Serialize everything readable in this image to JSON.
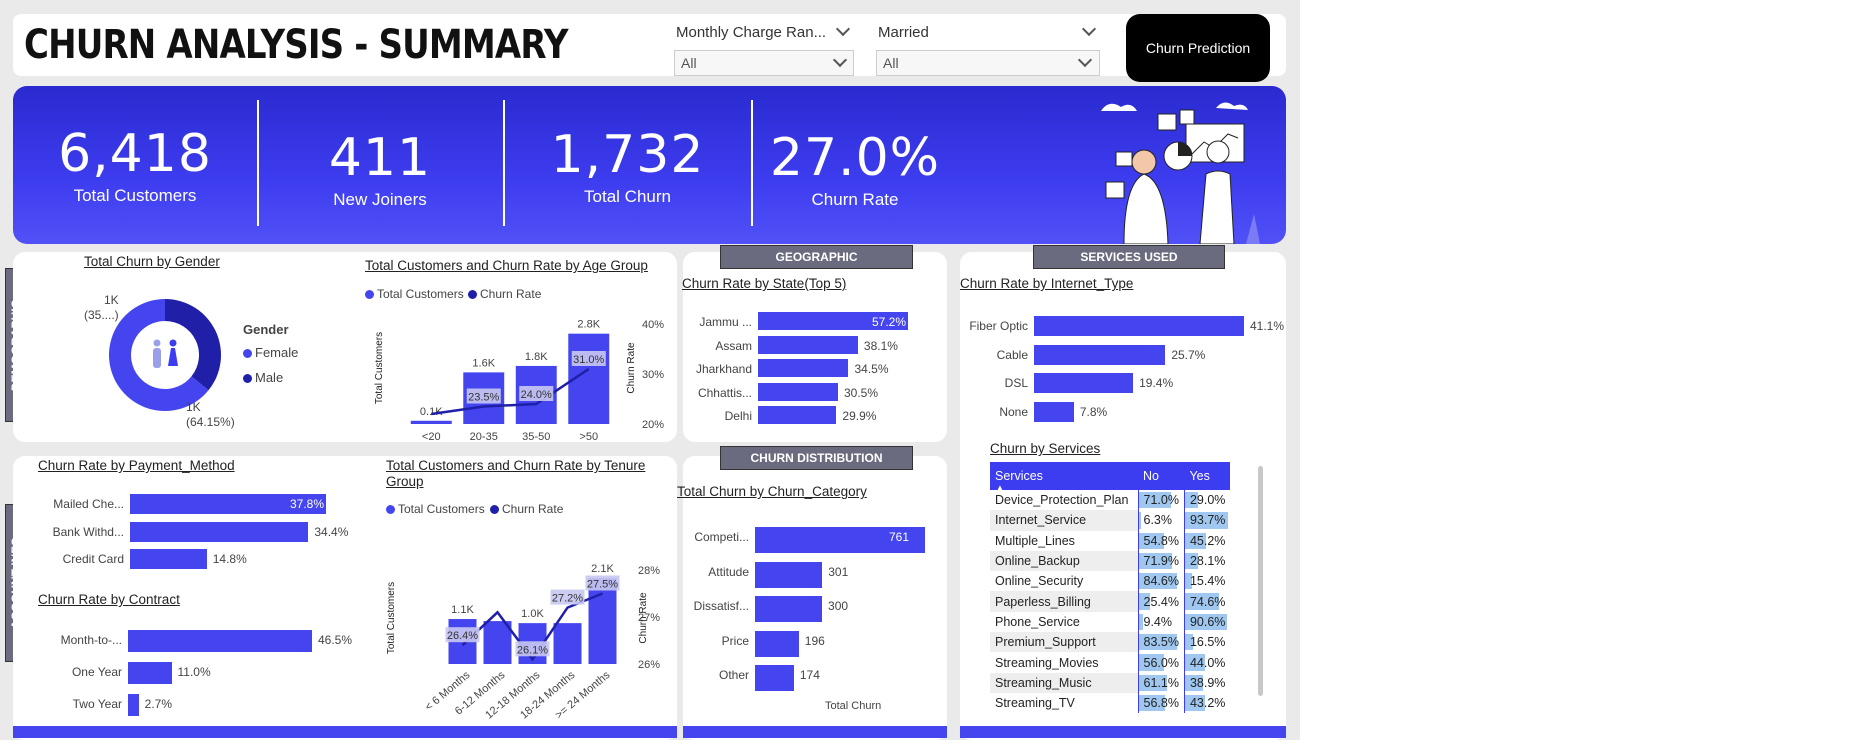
{
  "header": {
    "title": "CHURN ANALYSIS - SUMMARY",
    "slicers": [
      {
        "label": "Monthly Charge Ran...",
        "value": "All"
      },
      {
        "label": "Married",
        "value": "All"
      }
    ],
    "prediction_button": "Churn Prediction"
  },
  "kpis": [
    {
      "value": "6,418",
      "label": "Total Customers"
    },
    {
      "value": "411",
      "label": "New Joiners"
    },
    {
      "value": "1,732",
      "label": "Total Churn"
    },
    {
      "value": "27.0%",
      "label": "Churn Rate"
    }
  ],
  "tabs": {
    "demographic": "DEMOGRAPHIC",
    "account_info": "ACCOUNT INFO",
    "geographic": "GEOGRAPHIC",
    "services_used": "SERVICES USED",
    "churn_distribution": "CHURN DISTRIBUTION"
  },
  "colors": {
    "accent": "#4545f0",
    "dark": "#1f1fa8",
    "band": "#3434e0",
    "light": "#b5b5ee",
    "table_bar": "#9fc7ef"
  },
  "chart_data": [
    {
      "id": "gender",
      "type": "pie",
      "title": "Total Churn by Gender",
      "legend_title": "Gender",
      "categories": [
        "Female",
        "Male"
      ],
      "values": [
        1111,
        621
      ],
      "labels": [
        {
          "line1": "1K",
          "line2": "(35....)"
        },
        {
          "line1": "1K",
          "line2": "(64.15%)"
        }
      ]
    },
    {
      "id": "age",
      "type": "bar",
      "title": "Total Customers and Churn Rate by Age Group",
      "series_names": [
        "Total Customers",
        "Churn Rate"
      ],
      "categories": [
        "<20",
        "20-35",
        "35-50",
        ">50"
      ],
      "bar_labels": [
        "0.1K",
        "1.6K",
        "1.8K",
        "2.8K"
      ],
      "bar_values": [
        100,
        1600,
        1800,
        2800
      ],
      "bar_max": 3100,
      "rate_labels": [
        "",
        "23.5%",
        "24.0%",
        "31.0%"
      ],
      "rate_values": [
        22,
        23.5,
        24.0,
        31.0
      ],
      "rate_ticks": [
        "40%",
        "30%",
        "20%"
      ],
      "rate_range": [
        20,
        40
      ],
      "xlabel": "",
      "ylabel_left": "Total Customers",
      "ylabel_right": "Churn Rate"
    },
    {
      "id": "state",
      "type": "bar",
      "title": "Churn Rate by State(Top 5)",
      "categories": [
        "Jammu ...",
        "Assam",
        "Jharkhand",
        "Chhattis...",
        "Delhi"
      ],
      "values": [
        57.2,
        38.1,
        34.5,
        30.5,
        29.9
      ],
      "value_labels": [
        "57.2%",
        "38.1%",
        "34.5%",
        "30.5%",
        "29.9%"
      ],
      "max": 57.2
    },
    {
      "id": "internet",
      "type": "bar",
      "title": "Churn Rate by Internet_Type",
      "categories": [
        "Fiber Optic",
        "Cable",
        "DSL",
        "None"
      ],
      "values": [
        41.1,
        25.7,
        19.4,
        7.8
      ],
      "value_labels": [
        "41.1%",
        "25.7%",
        "19.4%",
        "7.8%"
      ],
      "max": 41.1
    },
    {
      "id": "payment",
      "type": "bar",
      "title": "Churn Rate by Payment_Method",
      "categories": [
        "Mailed Che...",
        "Bank Withd...",
        "Credit Card"
      ],
      "values": [
        37.8,
        34.4,
        14.8
      ],
      "value_labels": [
        "37.8%",
        "34.4%",
        "14.8%"
      ],
      "max": 37.8
    },
    {
      "id": "contract",
      "type": "bar",
      "title": "Churn Rate by Contract",
      "categories": [
        "Month-to-...",
        "One Year",
        "Two Year"
      ],
      "values": [
        46.5,
        11.0,
        2.7
      ],
      "value_labels": [
        "46.5%",
        "11.0%",
        "2.7%"
      ],
      "max": 46.5
    },
    {
      "id": "tenure",
      "type": "bar",
      "title": "Total Customers and Churn Rate by Tenure Group",
      "series_names": [
        "Total Customers",
        "Churn Rate"
      ],
      "categories": [
        "< 6 Months",
        "6-12 Months",
        "12-18 Months",
        "18-24 Months",
        ">= 24 Months"
      ],
      "bar_labels": [
        "1.1K",
        "",
        "1.0K",
        "",
        "2.1K"
      ],
      "bar_values": [
        1100,
        1050,
        1000,
        1000,
        2100
      ],
      "bar_max": 2300,
      "rate_labels": [
        "26.4%",
        "",
        "26.1%",
        "27.2%",
        "27.5%"
      ],
      "rate_values": [
        26.4,
        27.1,
        26.1,
        27.2,
        27.5
      ],
      "rate_ticks": [
        "28%",
        "27%",
        "26%"
      ],
      "rate_range": [
        26,
        28
      ],
      "ylabel_left": "Total Customers",
      "ylabel_right": "Churn Rate"
    },
    {
      "id": "category",
      "type": "bar",
      "title": "Total Churn by Churn_Category",
      "categories": [
        "Competi...",
        "Attitude",
        "Dissatisf...",
        "Price",
        "Other"
      ],
      "values": [
        761,
        301,
        300,
        196,
        174
      ],
      "value_labels": [
        "761",
        "301",
        "300",
        "196",
        "174"
      ],
      "max": 761,
      "xlabel": "Total Churn"
    },
    {
      "id": "services",
      "type": "table",
      "title": "Churn by Services",
      "columns": [
        "Services",
        "No",
        "Yes"
      ],
      "rows": [
        {
          "name": "Device_Protection_Plan",
          "no": "71.0%",
          "yes": "29.0%",
          "no_v": 71.0,
          "yes_v": 29.0
        },
        {
          "name": "Internet_Service",
          "no": "6.3%",
          "yes": "93.7%",
          "no_v": 6.3,
          "yes_v": 93.7
        },
        {
          "name": "Multiple_Lines",
          "no": "54.8%",
          "yes": "45.2%",
          "no_v": 54.8,
          "yes_v": 45.2
        },
        {
          "name": "Online_Backup",
          "no": "71.9%",
          "yes": "28.1%",
          "no_v": 71.9,
          "yes_v": 28.1
        },
        {
          "name": "Online_Security",
          "no": "84.6%",
          "yes": "15.4%",
          "no_v": 84.6,
          "yes_v": 15.4
        },
        {
          "name": "Paperless_Billing",
          "no": "25.4%",
          "yes": "74.6%",
          "no_v": 25.4,
          "yes_v": 74.6
        },
        {
          "name": "Phone_Service",
          "no": "9.4%",
          "yes": "90.6%",
          "no_v": 9.4,
          "yes_v": 90.6
        },
        {
          "name": "Premium_Support",
          "no": "83.5%",
          "yes": "16.5%",
          "no_v": 83.5,
          "yes_v": 16.5
        },
        {
          "name": "Streaming_Movies",
          "no": "56.0%",
          "yes": "44.0%",
          "no_v": 56.0,
          "yes_v": 44.0
        },
        {
          "name": "Streaming_Music",
          "no": "61.1%",
          "yes": "38.9%",
          "no_v": 61.1,
          "yes_v": 38.9
        },
        {
          "name": "Streaming_TV",
          "no": "56.8%",
          "yes": "43.2%",
          "no_v": 56.8,
          "yes_v": 43.2
        }
      ]
    }
  ]
}
